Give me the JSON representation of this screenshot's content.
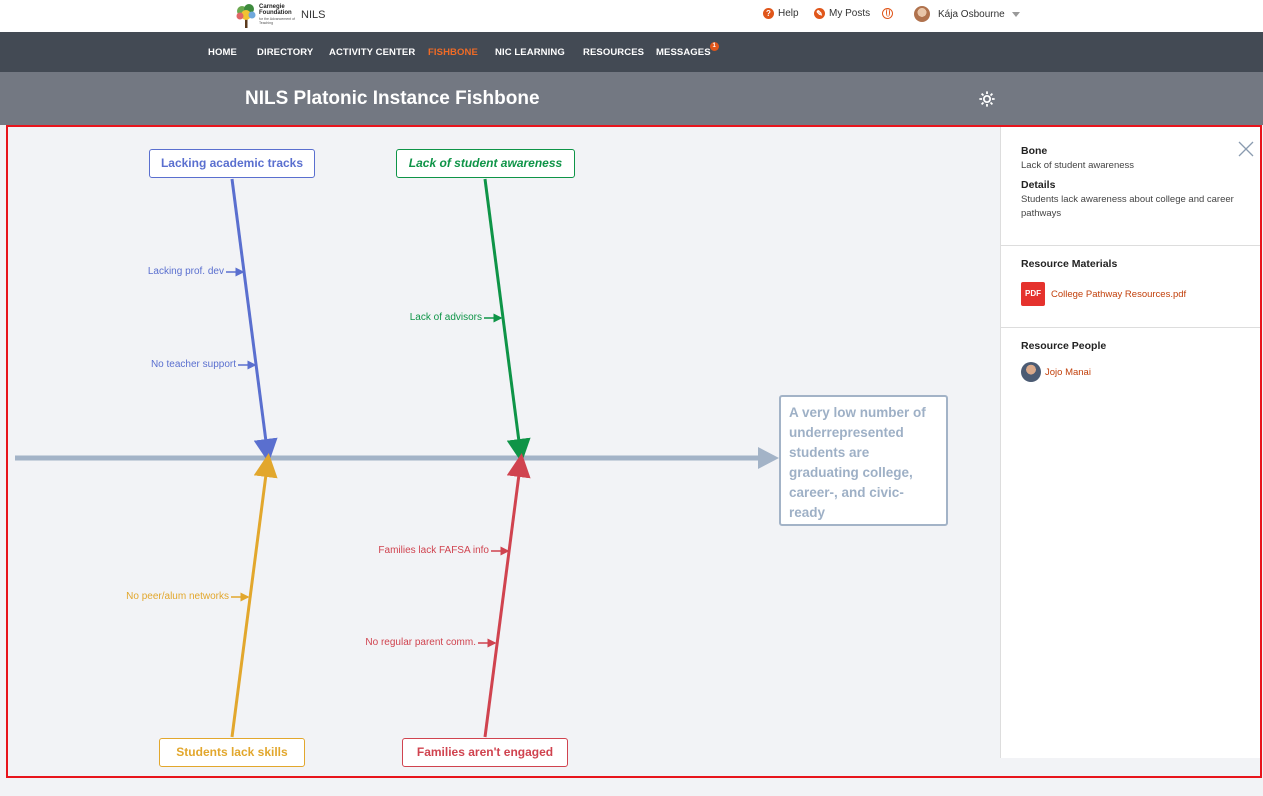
{
  "header": {
    "logo_line1": "Carnegie",
    "logo_line2": "Foundation",
    "logo_sub": "for the Advancement of Teaching",
    "app_name": "NILS",
    "help": "Help",
    "my_posts": "My Posts",
    "user_name": "Kája Osbourne"
  },
  "nav": {
    "items": [
      "HOME",
      "DIRECTORY",
      "ACTIVITY CENTER",
      "FISHBONE",
      "NIC LEARNING",
      "RESOURCES",
      "MESSAGES"
    ],
    "active": "FISHBONE",
    "messages_badge": "1"
  },
  "page": {
    "title": "NILS Platonic Instance Fishbone"
  },
  "fishbone": {
    "problem": "A very low number of underrepresented students are graduating college, career-, and civic-ready",
    "bones": [
      {
        "label": "Lacking academic tracks",
        "color": "#5a6fcf",
        "subs": [
          "Lacking prof. dev",
          "No teacher support"
        ]
      },
      {
        "label": "Lack of student awareness",
        "color": "#0e9447",
        "subs": [
          "Lack of advisors"
        ]
      },
      {
        "label": "Students lack skills",
        "color": "#e2a72d",
        "subs": [
          "No peer/alum networks"
        ]
      },
      {
        "label": "Families aren't engaged",
        "color": "#d0434f",
        "subs": [
          "Families lack FAFSA info",
          "No regular parent comm."
        ]
      }
    ],
    "spine_color": "#a3b3c7"
  },
  "panel": {
    "bone_heading": "Bone",
    "bone_value": "Lack of student awareness",
    "details_heading": "Details",
    "details_value": "Students lack awareness about college and career pathways",
    "materials_heading": "Resource Materials",
    "material_icon": "PDF",
    "material_file": "College Pathway Resources.pdf",
    "people_heading": "Resource People",
    "person": "Jojo Manai"
  }
}
